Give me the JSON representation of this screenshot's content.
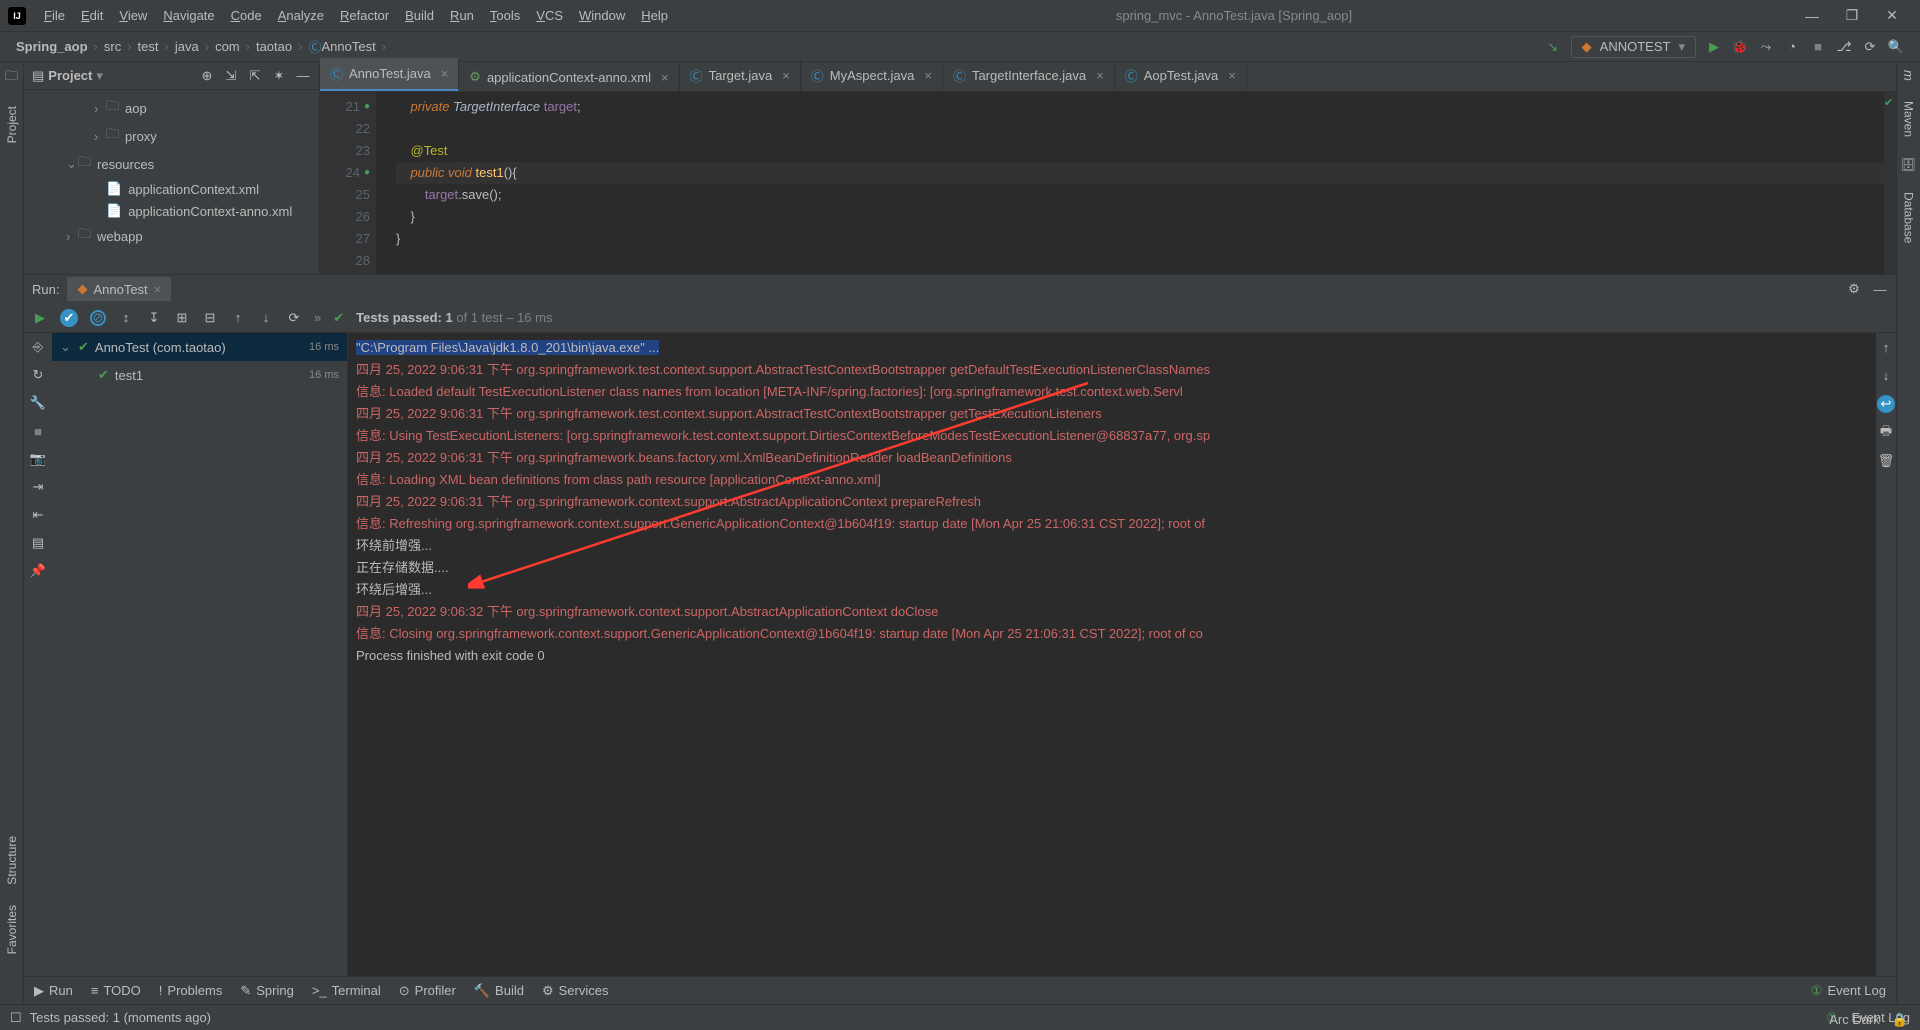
{
  "menu": [
    "File",
    "Edit",
    "View",
    "Navigate",
    "Code",
    "Analyze",
    "Refactor",
    "Build",
    "Run",
    "Tools",
    "VCS",
    "Window",
    "Help"
  ],
  "windowTitle": "spring_mvc - AnnoTest.java [Spring_aop]",
  "breadcrumbs": [
    "Spring_aop",
    "src",
    "test",
    "java",
    "com",
    "taotao",
    "AnnoTest"
  ],
  "runConfig": "ANNOTEST",
  "project": {
    "title": "Project",
    "tree": [
      {
        "indent": 5,
        "chev": "›",
        "icon": "folder",
        "label": "aop"
      },
      {
        "indent": 5,
        "chev": "›",
        "icon": "folder",
        "label": "proxy"
      },
      {
        "indent": 3,
        "chev": "⌄",
        "icon": "res",
        "label": "resources"
      },
      {
        "indent": 5,
        "chev": "",
        "icon": "xml",
        "label": "applicationContext.xml"
      },
      {
        "indent": 5,
        "chev": "",
        "icon": "xml",
        "label": "applicationContext-anno.xml"
      },
      {
        "indent": 3,
        "chev": "›",
        "icon": "folder",
        "label": "webapp"
      }
    ]
  },
  "tabs": [
    {
      "icon": "c",
      "label": "AnnoTest.java",
      "active": true
    },
    {
      "icon": "x",
      "label": "applicationContext-anno.xml"
    },
    {
      "icon": "c",
      "label": "Target.java"
    },
    {
      "icon": "c",
      "label": "MyAspect.java"
    },
    {
      "icon": "c",
      "label": "TargetInterface.java"
    },
    {
      "icon": "c",
      "label": "AopTest.java"
    }
  ],
  "code": {
    "lines": [
      {
        "n": 21,
        "g": "●",
        "html": "    <span class='kw'>private</span> <span class='ty'>TargetInterface</span> <span class='id'>target</span>;"
      },
      {
        "n": 22,
        "g": "",
        "html": ""
      },
      {
        "n": 23,
        "g": "",
        "html": "    <span class='an'>@Test</span>"
      },
      {
        "n": 24,
        "g": "●",
        "cur": true,
        "html": "    <span class='kw'>public void</span> <span class='fn'>test1</span>(){"
      },
      {
        "n": 25,
        "g": "",
        "html": "        <span class='id'>target</span>.save();"
      },
      {
        "n": 26,
        "g": "",
        "html": "    }"
      },
      {
        "n": 27,
        "g": "",
        "html": "}"
      },
      {
        "n": 28,
        "g": "",
        "html": ""
      }
    ]
  },
  "run": {
    "label": "Run:",
    "tab": "AnnoTest",
    "testsPassed": "Tests passed: 1",
    "testsTotal": " of 1 test – 16 ms",
    "tree": [
      {
        "lvl": 0,
        "chev": "⌄",
        "ok": true,
        "label": "AnnoTest (com.taotao)",
        "time": "16 ms",
        "sel": true
      },
      {
        "lvl": 1,
        "chev": "",
        "ok": true,
        "label": "test1",
        "time": "16 ms"
      }
    ],
    "console": [
      {
        "cls": "cmd",
        "t": "\"C:\\Program Files\\Java\\jdk1.8.0_201\\bin\\java.exe\" ..."
      },
      {
        "cls": "log-red",
        "t": "四月 25, 2022 9:06:31 下午 org.springframework.test.context.support.AbstractTestContextBootstrapper getDefaultTestExecutionListenerClassNames"
      },
      {
        "cls": "log-red",
        "t": "信息: Loaded default TestExecutionListener class names from location [META-INF/spring.factories]: [org.springframework.test.context.web.Servl"
      },
      {
        "cls": "log-red",
        "t": "四月 25, 2022 9:06:31 下午 org.springframework.test.context.support.AbstractTestContextBootstrapper getTestExecutionListeners"
      },
      {
        "cls": "log-red",
        "t": "信息: Using TestExecutionListeners: [org.springframework.test.context.support.DirtiesContextBeforeModesTestExecutionListener@68837a77, org.sp"
      },
      {
        "cls": "log-red",
        "t": "四月 25, 2022 9:06:31 下午 org.springframework.beans.factory.xml.XmlBeanDefinitionReader loadBeanDefinitions"
      },
      {
        "cls": "log-red",
        "t": "信息: Loading XML bean definitions from class path resource [applicationContext-anno.xml]"
      },
      {
        "cls": "log-red",
        "t": "四月 25, 2022 9:06:31 下午 org.springframework.context.support.AbstractApplicationContext prepareRefresh"
      },
      {
        "cls": "log-red",
        "t": "信息: Refreshing org.springframework.context.support.GenericApplicationContext@1b604f19: startup date [Mon Apr 25 21:06:31 CST 2022]; root of"
      },
      {
        "cls": "log-w",
        "t": "环绕前增强..."
      },
      {
        "cls": "log-w",
        "t": "正在存储数据...."
      },
      {
        "cls": "log-w",
        "t": "环绕后增强..."
      },
      {
        "cls": "log-red",
        "t": "四月 25, 2022 9:06:32 下午 org.springframework.context.support.AbstractApplicationContext doClose"
      },
      {
        "cls": "log-red",
        "t": "信息: Closing org.springframework.context.support.GenericApplicationContext@1b604f19: startup date [Mon Apr 25 21:06:31 CST 2022]; root of co"
      },
      {
        "cls": "log-w",
        "t": ""
      },
      {
        "cls": "log-w",
        "t": "Process finished with exit code 0"
      }
    ]
  },
  "bottomTabs": [
    {
      "i": "▶",
      "l": "Run"
    },
    {
      "i": "≡",
      "l": "TODO"
    },
    {
      "i": "!",
      "l": "Problems"
    },
    {
      "i": "✎",
      "l": "Spring"
    },
    {
      "i": ">_",
      "l": "Terminal"
    },
    {
      "i": "⊙",
      "l": "Profiler"
    },
    {
      "i": "🔨",
      "l": "Build"
    },
    {
      "i": "⚙",
      "l": "Services"
    }
  ],
  "eventLog": "Event Log",
  "status": {
    "msg": "Tests passed: 1 (moments ago)",
    "theme": "Arc Dark"
  },
  "leftStrip": [
    "Project"
  ],
  "leftStripBottom": [
    "Structure",
    "Favorites"
  ],
  "rightStrip": [
    "Maven",
    "Database"
  ]
}
